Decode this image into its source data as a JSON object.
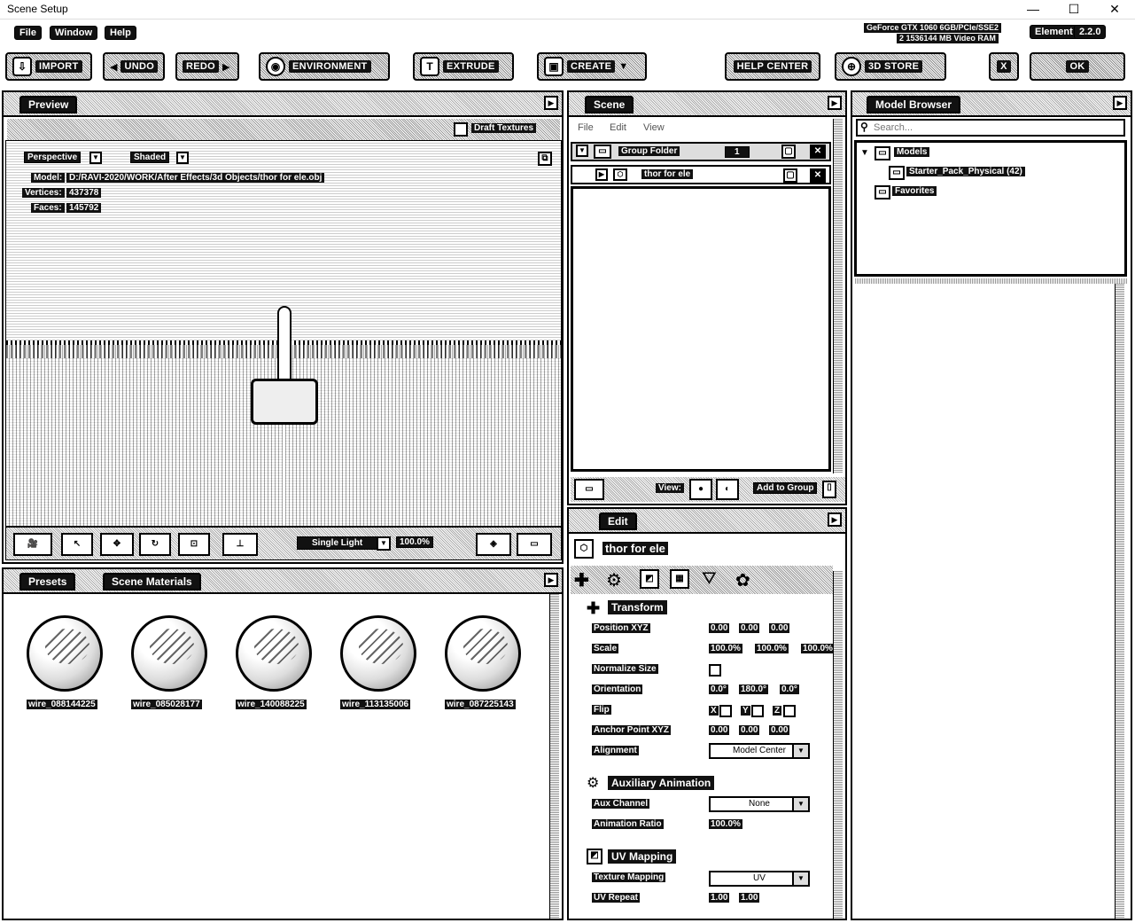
{
  "window": {
    "title": "Scene Setup",
    "min": "—",
    "max": "☐",
    "close": "✕"
  },
  "menu": {
    "file": "File",
    "window": "Window",
    "help": "Help"
  },
  "gpu": {
    "line1": "GeForce GTX 1060 6GB/PCIe/SSE2",
    "line2": "2 1536144 MB Video RAM"
  },
  "element": {
    "label": "Element",
    "version": "2.2.0"
  },
  "toolbar": {
    "import": "IMPORT",
    "undo": "UNDO",
    "redo": "REDO",
    "environment": "ENVIRONMENT",
    "extrude": "EXTRUDE",
    "create": "CREATE",
    "help_center": "HELP CENTER",
    "store": "3D STORE",
    "close": "X",
    "ok": "OK"
  },
  "preview": {
    "tab": "Preview",
    "draft_textures": "Draft Textures",
    "perspective": "Perspective",
    "shaded": "Shaded",
    "model_label": "Model:",
    "model_path": "D:/RAVI-2020/WORK/After Effects/3d Objects/thor for ele.obj",
    "vertices_label": "Vertices:",
    "vertices": "437378",
    "faces_label": "Faces:",
    "faces": "145792",
    "light": "Single Light",
    "light_pct": "100.0%"
  },
  "presets": {
    "tab_presets": "Presets",
    "tab_materials": "Scene Materials",
    "items": [
      "wire_088144225",
      "wire_085028177",
      "wire_140088225",
      "wire_113135006",
      "wire_087225143"
    ]
  },
  "scene": {
    "tab": "Scene",
    "menu_file": "File",
    "menu_edit": "Edit",
    "menu_view": "View",
    "group": "Group Folder",
    "group_count": "1",
    "item": "thor for ele",
    "view_label": "View:",
    "add_to_group": "Add to Group"
  },
  "edit": {
    "tab": "Edit",
    "object_name": "thor for ele",
    "transform": "Transform",
    "position_label": "Position XYZ",
    "position": [
      "0.00",
      "0.00",
      "0.00"
    ],
    "scale_label": "Scale",
    "scale": [
      "100.0%",
      "100.0%",
      "100.0%"
    ],
    "normalize_label": "Normalize Size",
    "orientation_label": "Orientation",
    "orientation": [
      "0.0°",
      "180.0°",
      "0.0°"
    ],
    "flip_label": "Flip",
    "flip_x": "X",
    "flip_y": "Y",
    "flip_z": "Z",
    "anchor_label": "Anchor Point XYZ",
    "anchor": [
      "0.00",
      "0.00",
      "0.00"
    ],
    "alignment_label": "Alignment",
    "alignment": "Model Center",
    "aux_section": "Auxiliary Animation",
    "aux_channel_label": "Aux Channel",
    "aux_channel": "None",
    "anim_ratio_label": "Animation Ratio",
    "anim_ratio": "100.0%",
    "uv_section": "UV Mapping",
    "texture_mapping_label": "Texture Mapping",
    "texture_mapping": "UV",
    "uv_repeat_label": "UV Repeat",
    "uv_repeat": [
      "1.00",
      "1.00"
    ]
  },
  "model_browser": {
    "tab": "Model Browser",
    "search_placeholder": "Search...",
    "models": "Models",
    "starter_pack": "Starter_Pack_Physical (42)",
    "favorites": "Favorites"
  }
}
